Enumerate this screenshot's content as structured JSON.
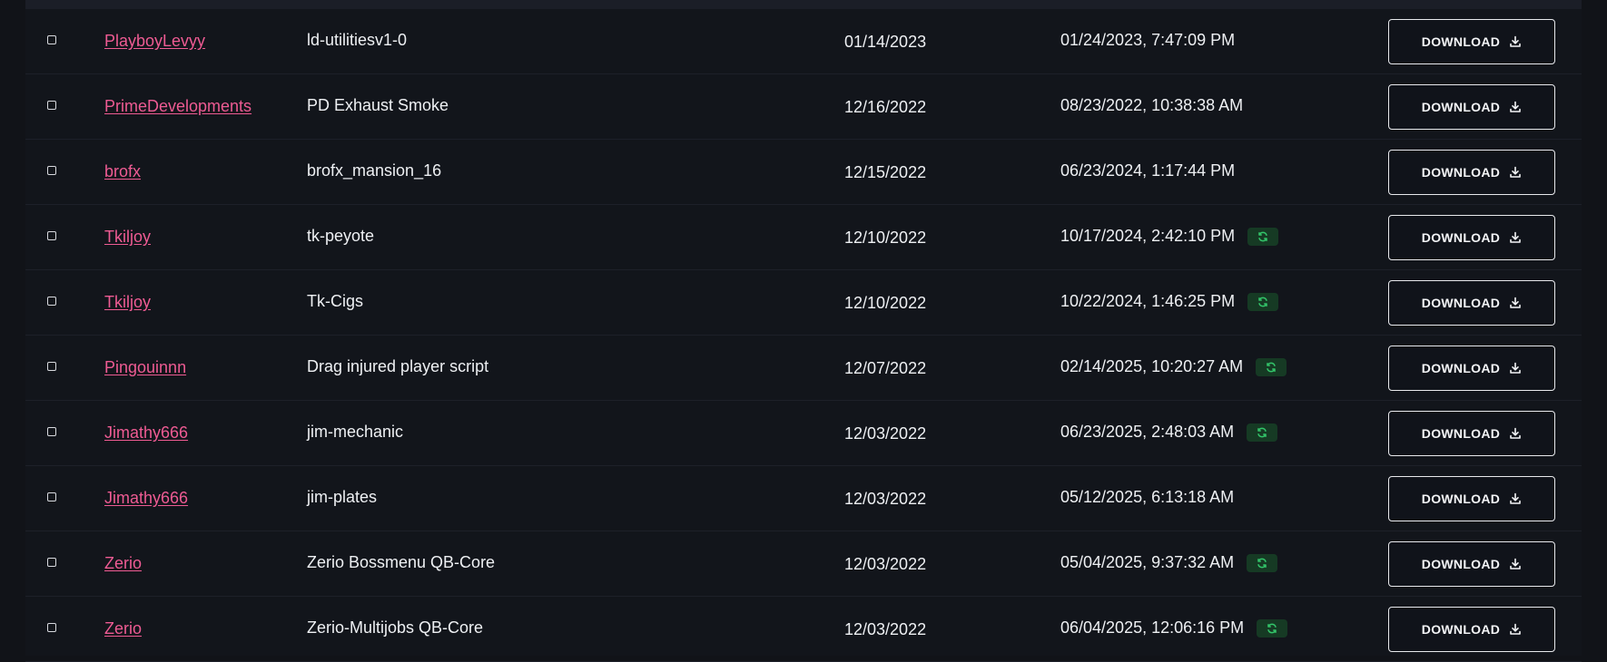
{
  "colors": {
    "background": "#111318",
    "author_link": "#ee5b93",
    "badge_bg": "#163a24",
    "badge_icon": "#33c56a"
  },
  "download_label": "DOWNLOAD",
  "rows": [
    {
      "author": "PlayboyLevyy",
      "name": "ld-utilitiesv1-0",
      "created": "01/14/2023",
      "updated": "01/24/2023, 7:47:09 PM",
      "update_badge": false
    },
    {
      "author": "PrimeDevelopments",
      "name": "PD Exhaust Smoke",
      "created": "12/16/2022",
      "updated": "08/23/2022, 10:38:38 AM",
      "update_badge": false
    },
    {
      "author": "brofx",
      "name": "brofx_mansion_16",
      "created": "12/15/2022",
      "updated": "06/23/2024, 1:17:44 PM",
      "update_badge": false
    },
    {
      "author": "Tkiljoy",
      "name": "tk-peyote",
      "created": "12/10/2022",
      "updated": "10/17/2024, 2:42:10 PM",
      "update_badge": true
    },
    {
      "author": "Tkiljoy",
      "name": "Tk-Cigs",
      "created": "12/10/2022",
      "updated": "10/22/2024, 1:46:25 PM",
      "update_badge": true
    },
    {
      "author": "Pingouinnn",
      "name": "Drag injured player script",
      "created": "12/07/2022",
      "updated": "02/14/2025, 10:20:27 AM",
      "update_badge": true
    },
    {
      "author": "Jimathy666",
      "name": "jim-mechanic",
      "created": "12/03/2022",
      "updated": "06/23/2025, 2:48:03 AM",
      "update_badge": true
    },
    {
      "author": "Jimathy666",
      "name": "jim-plates",
      "created": "12/03/2022",
      "updated": "05/12/2025, 6:13:18 AM",
      "update_badge": false
    },
    {
      "author": "Zerio",
      "name": "Zerio Bossmenu QB-Core",
      "created": "12/03/2022",
      "updated": "05/04/2025, 9:37:32 AM",
      "update_badge": true
    },
    {
      "author": "Zerio",
      "name": "Zerio-Multijobs QB-Core",
      "created": "12/03/2022",
      "updated": "06/04/2025, 12:06:16 PM",
      "update_badge": true
    }
  ]
}
